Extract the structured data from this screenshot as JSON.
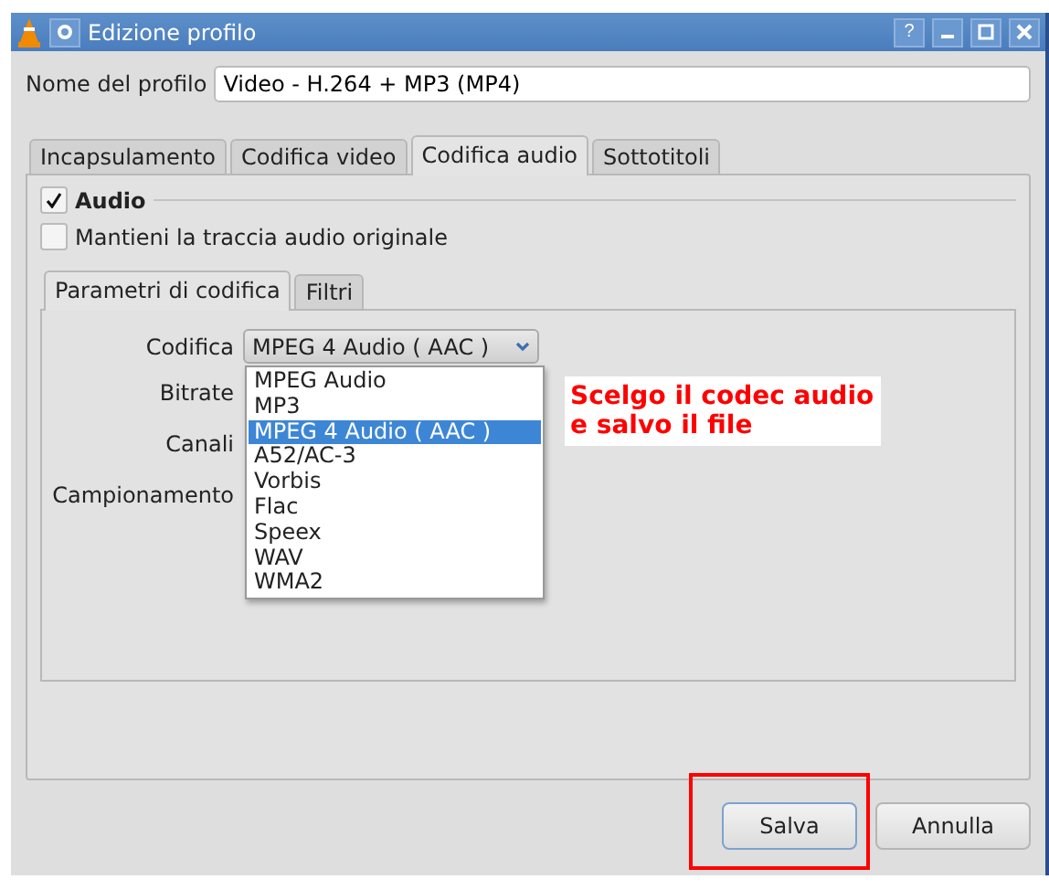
{
  "window": {
    "title": "Edizione profilo",
    "controls": [
      {
        "kind": "help",
        "label": "?"
      },
      {
        "kind": "minimize"
      },
      {
        "kind": "maximize"
      },
      {
        "kind": "close"
      }
    ]
  },
  "profile": {
    "label": "Nome del profilo",
    "value": "Video - H.264 + MP3 (MP4)"
  },
  "tabs": [
    {
      "label": "Incapsulamento",
      "selected": false
    },
    {
      "label": "Codifica video",
      "selected": false
    },
    {
      "label": "Codifica audio",
      "selected": true
    },
    {
      "label": "Sottotitoli",
      "selected": false
    }
  ],
  "audio": {
    "label": "Audio",
    "checked": true
  },
  "keep_original": {
    "label": "Mantieni la traccia audio originale",
    "checked": false
  },
  "sub_tabs": [
    {
      "label": "Parametri di codifica",
      "selected": true
    },
    {
      "label": "Filtri",
      "selected": false
    }
  ],
  "codec": {
    "label": "Codifica",
    "value": "MPEG 4 Audio ( AAC )",
    "options": [
      {
        "label": "MPEG Audio",
        "selected": false
      },
      {
        "label": "MP3",
        "selected": false
      },
      {
        "label": "MPEG 4 Audio ( AAC )",
        "selected": true
      },
      {
        "label": "A52/AC-3",
        "selected": false
      },
      {
        "label": "Vorbis",
        "selected": false
      },
      {
        "label": "Flac",
        "selected": false
      },
      {
        "label": "Speex",
        "selected": false
      },
      {
        "label": "WAV",
        "selected": false
      },
      {
        "label": "WMA2",
        "selected": false
      }
    ]
  },
  "fields": [
    "Bitrate",
    "Canali",
    "Campionamento"
  ],
  "annotation": [
    "Scelgo il codec audio",
    "e salvo il file"
  ],
  "buttons": [
    {
      "label": "Salva",
      "highlighted": true
    },
    {
      "label": "Annulla",
      "highlighted": false
    }
  ]
}
